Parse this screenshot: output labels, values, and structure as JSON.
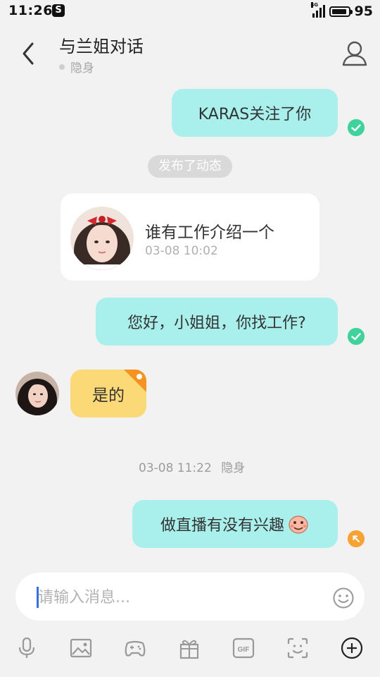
{
  "status": {
    "time": "11:26",
    "app_icon_letter": "S",
    "network": "4G",
    "battery": "95",
    "battery_level": 0.95
  },
  "header": {
    "title": "与兰姐对话",
    "status": "隐身"
  },
  "messages": {
    "m1": {
      "text": "KARAS关注了你"
    },
    "system_pill": "发布了动态",
    "post": {
      "text": "谁有工作介绍一个",
      "time": "03-08 10:02"
    },
    "m2": {
      "text": "您好，小姐姐，你找工作?"
    },
    "m3": {
      "text": "是的"
    },
    "timestamp": {
      "time": "03-08 11:22",
      "status": "隐身"
    },
    "m4": {
      "text": "做直播有没有兴趣"
    }
  },
  "input": {
    "placeholder": "请输入消息..."
  },
  "toolbar": {
    "gif_label": "GIF"
  },
  "colors": {
    "outgoing_bubble": "#a9f0ec",
    "incoming_bubble": "#fbd977",
    "read_check": "#3ed39b",
    "pending": "#f7a231"
  },
  "icons": [
    "back-icon",
    "profile-icon",
    "read-check-icon",
    "pending-icon",
    "emoji-icon",
    "mic-icon",
    "image-icon",
    "game-icon",
    "gift-icon",
    "gif-icon",
    "face-scan-icon",
    "plus-icon"
  ]
}
